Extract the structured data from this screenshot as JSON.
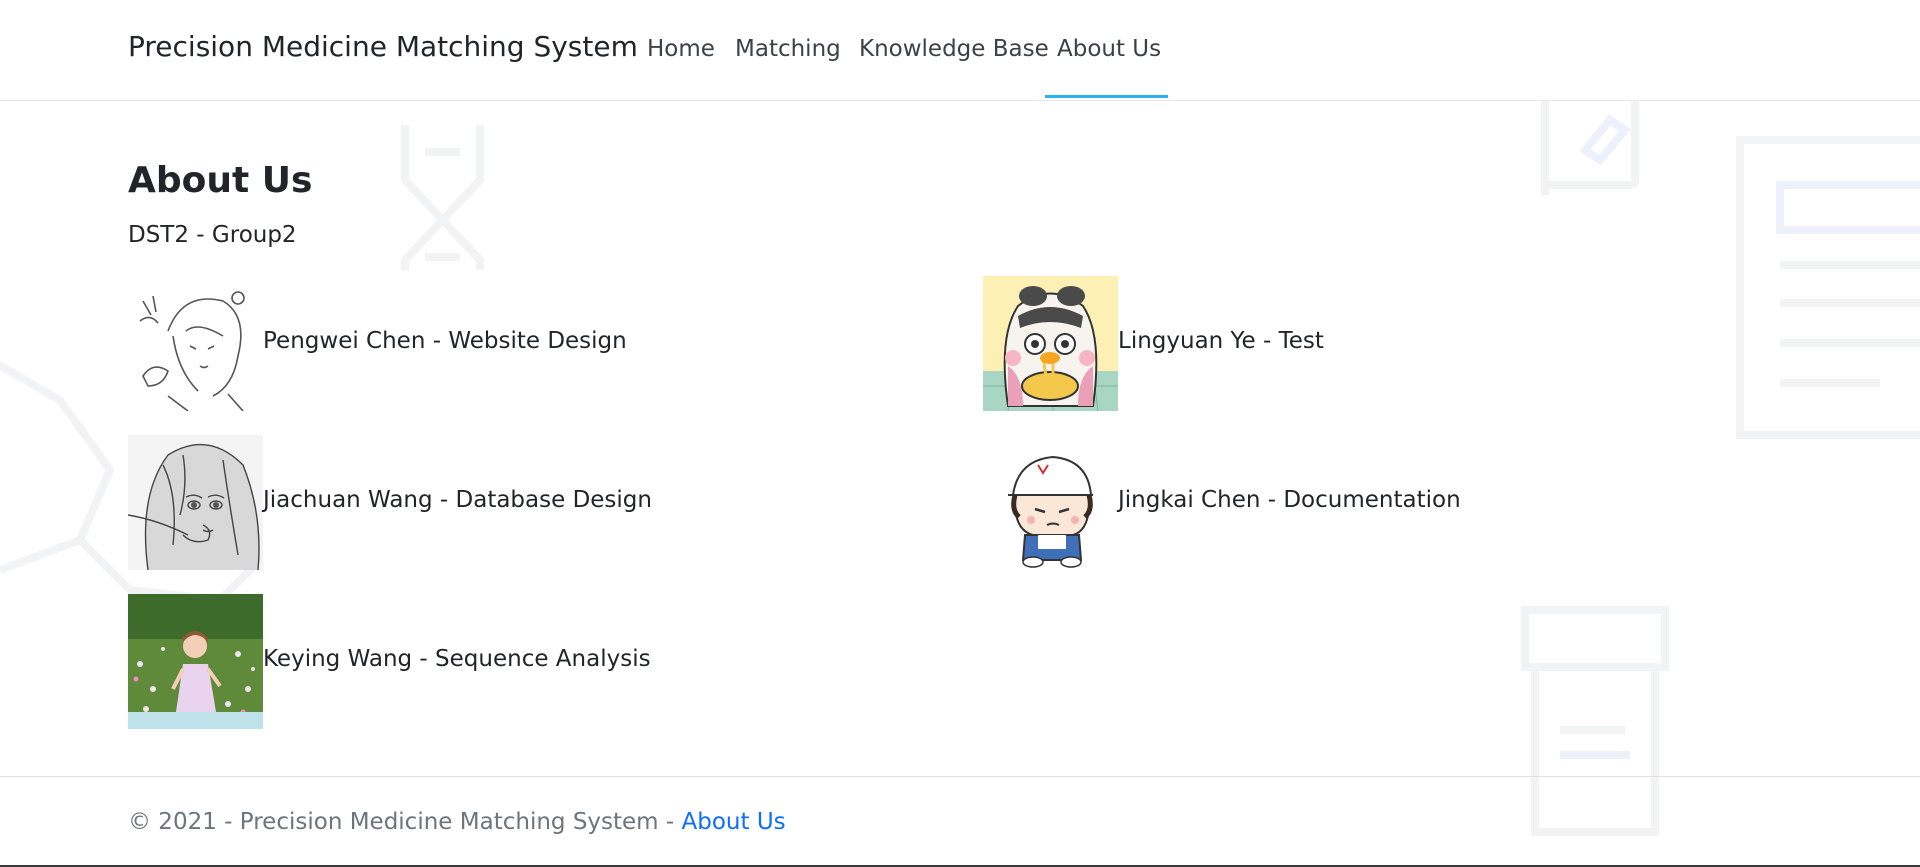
{
  "navbar": {
    "brand": "Precision Medicine Matching System",
    "links": [
      {
        "label": "Home",
        "active": false
      },
      {
        "label": "Matching",
        "active": false
      },
      {
        "label": "Knowledge Base",
        "active": false
      },
      {
        "label": "About Us",
        "active": true
      }
    ],
    "accent_color": "#2ab2f0"
  },
  "main": {
    "title": "About Us",
    "subtitle": "DST2 - Group2",
    "members": [
      {
        "label": "Pengwei Chen - Website Design",
        "avatar_icon": "sketch-girl-avatar-icon"
      },
      {
        "label": "Lingyuan Ye - Test",
        "avatar_icon": "cartoon-eating-avatar-icon"
      },
      {
        "label": "Jiachuan Wang - Database Design",
        "avatar_icon": "sketch-longhair-avatar-icon"
      },
      {
        "label": "Jingkai Chen - Documentation",
        "avatar_icon": "cartoon-cap-boy-avatar-icon"
      },
      {
        "label": "Keying Wang - Sequence Analysis",
        "avatar_icon": "child-photo-avatar-icon"
      }
    ]
  },
  "footer": {
    "text": "© 2021 - Precision Medicine Matching System - ",
    "link_label": "About Us",
    "link_color": "#0d6efd"
  }
}
